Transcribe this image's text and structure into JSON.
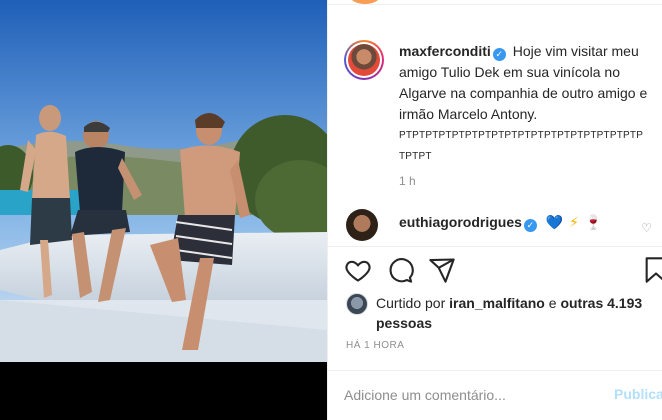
{
  "post": {
    "username": "maxferconditi",
    "caption": "Hoje vim visitar meu amigo Tulio Dek em sua vinícola no Algarve na companhia de outro amigo e irmão Marcelo Antony.",
    "caption_tail": "PTPTPTPTPTPTPTPTPTPTPTPTPTPTPTPTPTPTPTPTPT",
    "time_ago": "1 h"
  },
  "comment": {
    "username": "euthiagorodrigues",
    "emojis": [
      "💙",
      "⚡",
      "🍷"
    ]
  },
  "likes": {
    "prefix": "Curtido por",
    "user": "iran_malfitano",
    "connector": "e",
    "others": "outras 4.193 pessoas"
  },
  "date_label": "HÁ 1 HORA",
  "input": {
    "placeholder": "Adicione um comentário...",
    "post_label": "Publica"
  },
  "icons": {
    "like": "heart-icon",
    "comment": "comment-icon",
    "share": "share-icon",
    "save": "bookmark-icon",
    "verified": "verified-badge-icon"
  },
  "colors": {
    "verified": "#3897f0",
    "post_disabled": "#b2dffc",
    "muted": "#8e8e8e"
  }
}
